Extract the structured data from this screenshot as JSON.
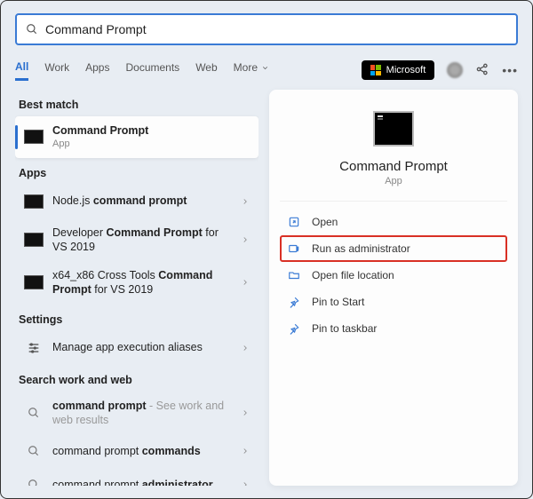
{
  "search": {
    "value": "Command Prompt"
  },
  "tabs": [
    "All",
    "Work",
    "Apps",
    "Documents",
    "Web",
    "More"
  ],
  "active_tab": "All",
  "ms_label": "Microsoft",
  "sections": {
    "best_match": {
      "title": "Best match",
      "item": {
        "title": "Command Prompt",
        "sub": "App"
      }
    },
    "apps": {
      "title": "Apps",
      "items": [
        {
          "pre": "Node.js ",
          "bold": "command prompt",
          "post": ""
        },
        {
          "pre": "Developer ",
          "bold": "Command Prompt",
          "post": " for VS 2019"
        },
        {
          "pre": "x64_x86 Cross Tools ",
          "bold": "Command Prompt",
          "post": " for VS 2019"
        }
      ]
    },
    "settings": {
      "title": "Settings",
      "items": [
        {
          "label": "Manage app execution aliases"
        }
      ]
    },
    "web": {
      "title": "Search work and web",
      "items": [
        {
          "bold": "command prompt",
          "post": " - See work and web results"
        },
        {
          "pre": "command prompt ",
          "bold": "commands"
        },
        {
          "pre": "command prompt ",
          "bold": "administrator"
        }
      ]
    }
  },
  "preview": {
    "title": "Command Prompt",
    "sub": "App",
    "actions": [
      {
        "icon": "open",
        "label": "Open"
      },
      {
        "icon": "admin",
        "label": "Run as administrator",
        "highlight": true
      },
      {
        "icon": "folder",
        "label": "Open file location"
      },
      {
        "icon": "pin",
        "label": "Pin to Start"
      },
      {
        "icon": "pin",
        "label": "Pin to taskbar"
      }
    ]
  }
}
